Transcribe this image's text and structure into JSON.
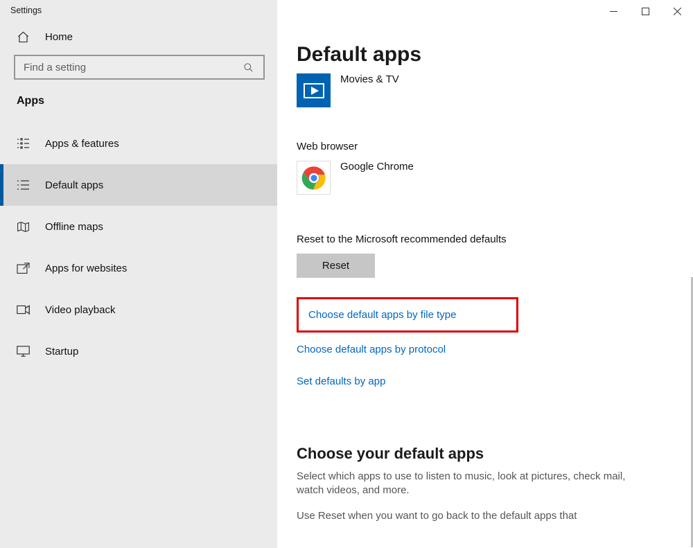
{
  "window_title": "Settings",
  "home_label": "Home",
  "search_placeholder": "Find a setting",
  "section_title": "Apps",
  "nav": [
    {
      "label": "Apps & features"
    },
    {
      "label": "Default apps"
    },
    {
      "label": "Offline maps"
    },
    {
      "label": "Apps for websites"
    },
    {
      "label": "Video playback"
    },
    {
      "label": "Startup"
    }
  ],
  "page_title": "Default apps",
  "entries": {
    "movies": "Movies & TV",
    "browser_header": "Web browser",
    "chrome": "Google Chrome"
  },
  "reset": {
    "line": "Reset to the Microsoft recommended defaults",
    "button": "Reset"
  },
  "links": {
    "by_file_type": "Choose default apps by file type",
    "by_protocol": "Choose default apps by protocol",
    "by_app": "Set defaults by app"
  },
  "footer": {
    "title": "Choose your default apps",
    "p1": "Select which apps to use to listen to music, look at pictures, check mail, watch videos, and more.",
    "p2": "Use Reset when you want to go back to the default apps that"
  }
}
